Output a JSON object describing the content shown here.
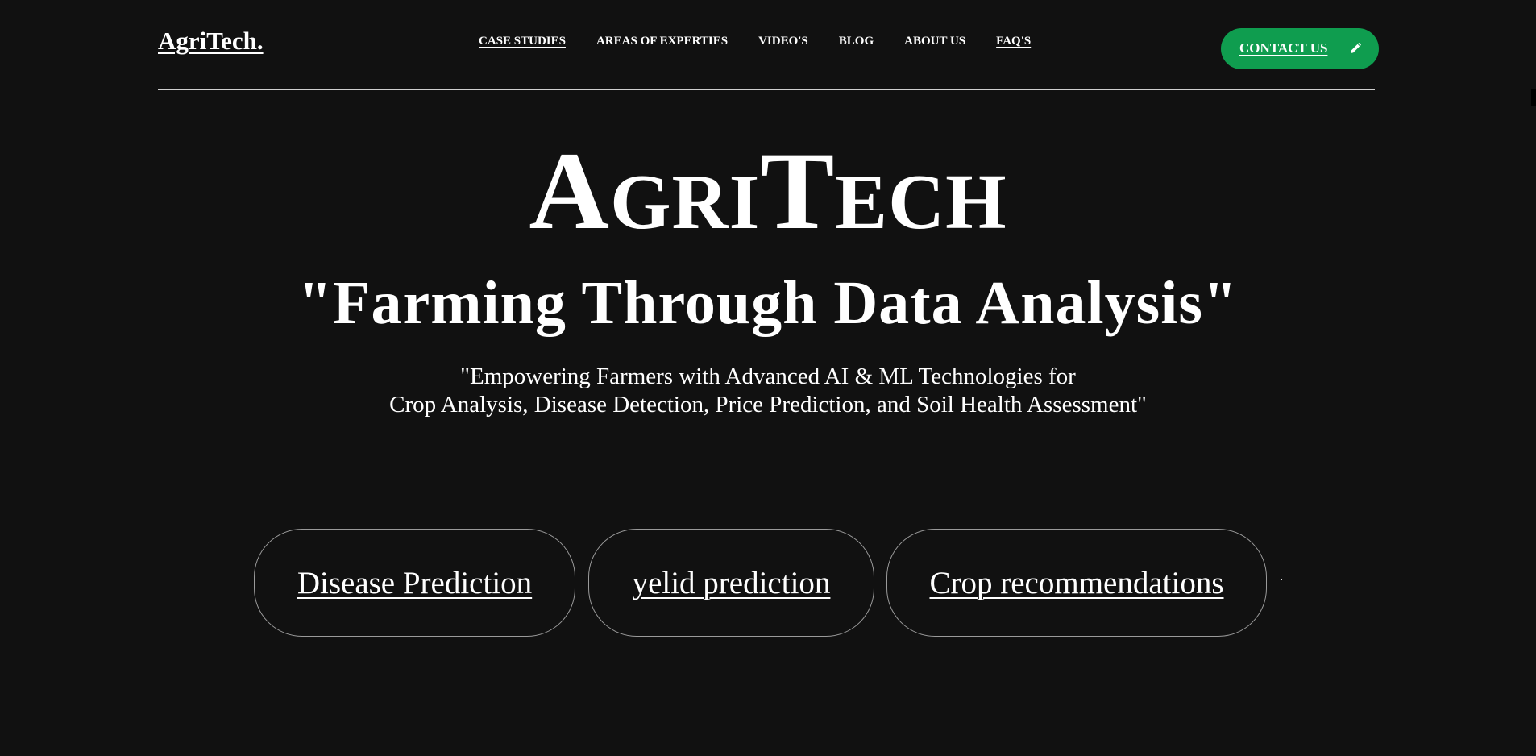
{
  "header": {
    "logo": "AgriTech.",
    "nav": [
      {
        "label": "CASE STUDIES",
        "underlined": true
      },
      {
        "label": "AREAS OF EXPERTIES",
        "underlined": false
      },
      {
        "label": "VIDEO'S",
        "underlined": false
      },
      {
        "label": "BLOG",
        "underlined": false
      },
      {
        "label": "ABOUT US",
        "underlined": false
      },
      {
        "label": "FAQ'S",
        "underlined": true
      }
    ],
    "contact": {
      "label": "CONTACT US",
      "icon": "pencil-icon",
      "color": "#0f9d4f"
    }
  },
  "hero": {
    "title": "AgriTech",
    "tagline": "\"Farming Through Data Analysis\"",
    "subtitle_line1": "\"Empowering Farmers with Advanced AI & ML Technologies for",
    "subtitle_line2": "Crop Analysis, Disease Detection, Price Prediction, and Soil Health Assessment\""
  },
  "features": [
    {
      "label": "Disease Prediction"
    },
    {
      "label": "yelid prediction"
    },
    {
      "label": "Crop recommendations"
    }
  ],
  "colors": {
    "background": "#111111",
    "text": "#ffffff",
    "accent": "#0f9d4f",
    "card_border": "#9a9a9a"
  }
}
